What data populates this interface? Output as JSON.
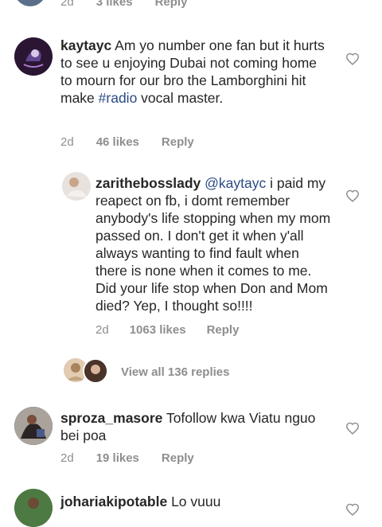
{
  "top": {
    "time": "2d",
    "likes": "3 likes",
    "reply": "Reply"
  },
  "comments": [
    {
      "user": "kaytayc",
      "text_before": "Am yo number one fan but it hurts to see u enjoying Dubai not coming home to mourn for our bro the Lamborghini hit make ",
      "hashtag": "#radio",
      "text_after": " vocal master.",
      "time": "2d",
      "likes": "46 likes",
      "reply": "Reply"
    },
    {
      "user": "zarithebosslady",
      "mention": "@kaytayc",
      "text": "i paid my reapect on fb, i domt remember anybody's life stopping when my mom passed on. I don't get it when y'all always wanting to find fault when there is none when it comes to me. Did your life stop when Don and Mom died? Yep, I thought so!!!!",
      "time": "2d",
      "likes": "1063 likes",
      "reply": "Reply"
    },
    {
      "user": "sproza_masore",
      "text": "Tofollow kwa Viatu nguo bei poa",
      "time": "2d",
      "likes": "19 likes",
      "reply": "Reply"
    },
    {
      "user": "johariakipotable",
      "text": "Lo vuuu"
    }
  ],
  "view_replies": "View all 136 replies",
  "icons": {
    "like": "heart-outline-icon"
  },
  "colors": {
    "text": "#262626",
    "meta": "#8e8e8e",
    "hashtag": "#2b4a85"
  }
}
